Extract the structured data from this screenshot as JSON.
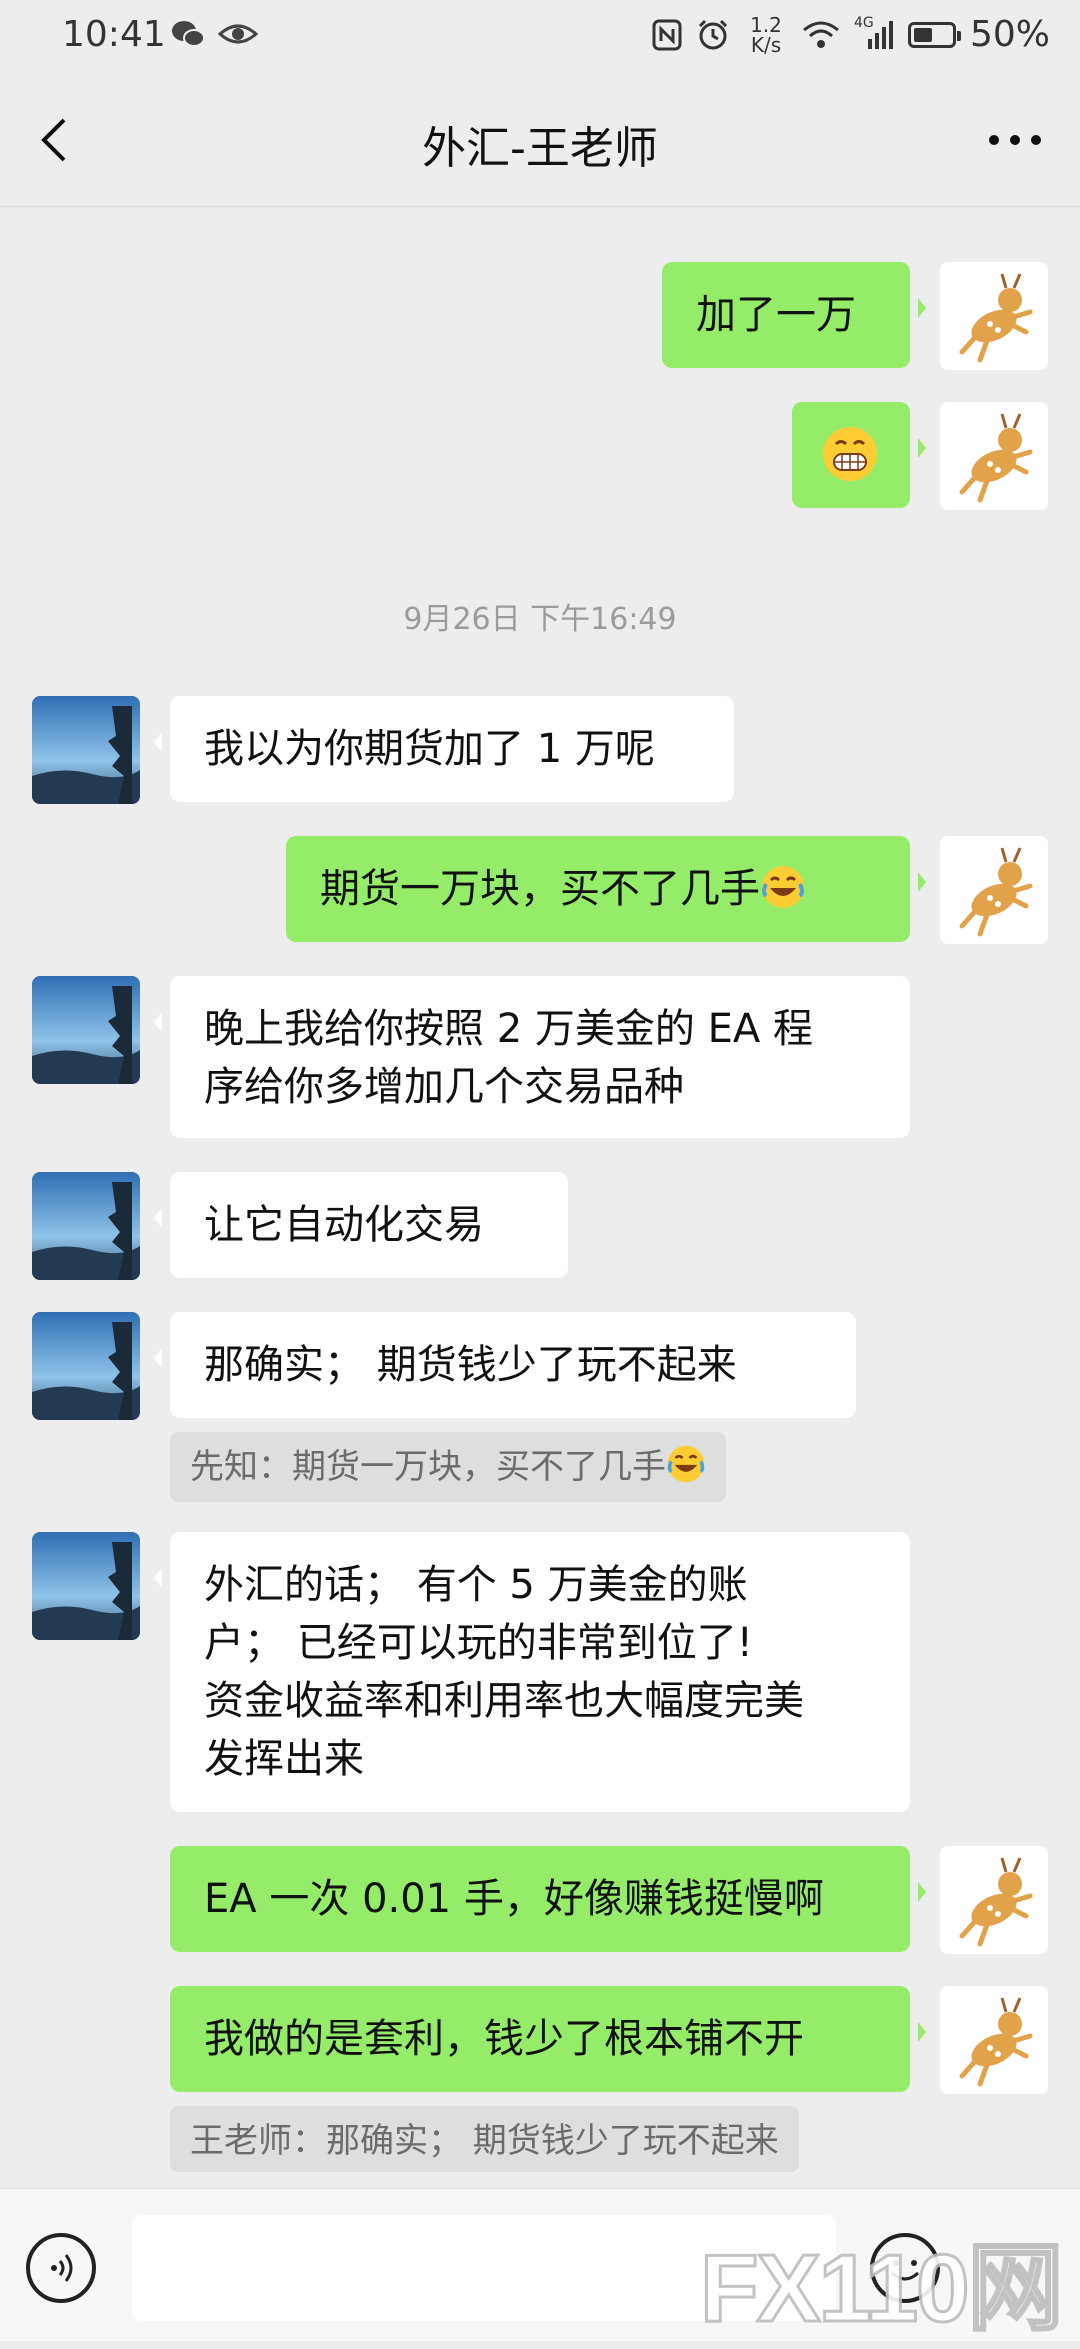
{
  "status_bar": {
    "time": "10:41",
    "net_speed_value": "1.2",
    "net_speed_unit": "K/s",
    "signal_label": "4G",
    "battery_percent": "50%",
    "battery_level": 0.5
  },
  "header": {
    "title": "外汇-王老师",
    "back_icon": "chevron-left-icon",
    "more_icon": "more-dots-icon"
  },
  "messages": [
    {
      "side": "out",
      "text": "加了一万"
    },
    {
      "side": "out",
      "emoji": "grin-emoji"
    },
    {
      "type": "timestamp",
      "text": "9月26日 下午16:49"
    },
    {
      "side": "in",
      "text": "我以为你期货加了 1 万呢"
    },
    {
      "side": "out",
      "text": "期货一万块，买不了几手",
      "emoji": "laugh-tears-emoji"
    },
    {
      "side": "in",
      "lines": [
        "晚上我给你按照 2 万美金的 EA 程",
        "序给你多增加几个交易品种"
      ]
    },
    {
      "side": "in",
      "text": "让它自动化交易"
    },
    {
      "side": "in",
      "text": "那确实； 期货钱少了玩不起来",
      "quote": "先知：期货一万块，买不了几手",
      "quote_emoji": "laugh-tears-emoji"
    },
    {
      "side": "in",
      "lines": [
        "外汇的话； 有个 5 万美金的账",
        "户； 已经可以玩的非常到位了!",
        "资金收益率和利用率也大幅度完美",
        "发挥出来"
      ]
    },
    {
      "side": "out",
      "text": "EA 一次 0.01 手，好像赚钱挺慢啊"
    },
    {
      "side": "out",
      "text": "我做的是套利，钱少了根本铺不开",
      "quote": "王老师：那确实； 期货钱少了玩不起来"
    }
  ],
  "input_bar": {
    "voice_icon": "voice-icon",
    "emoji_icon": "emoji-icon",
    "input_value": ""
  },
  "watermark": "FX110网",
  "colors": {
    "background": "#ededed",
    "bubble_out": "#95ec69",
    "bubble_in": "#ffffff",
    "quote_bg": "#dedede"
  }
}
